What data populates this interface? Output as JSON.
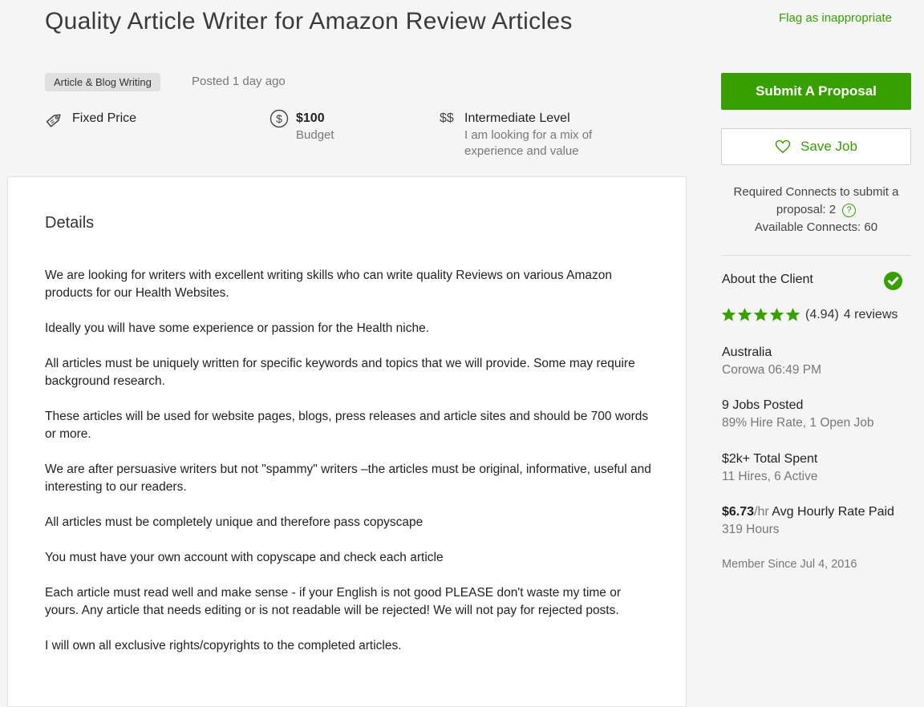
{
  "job": {
    "title": "Quality Article Writer for Amazon Review Articles",
    "flag_label": "Flag as inappropriate",
    "category": "Article & Blog Writing",
    "posted": "Posted 1 day ago",
    "price_type": "Fixed Price",
    "budget_value": "$100",
    "budget_label": "Budget",
    "level_symbol": "$$",
    "level_title": "Intermediate Level",
    "level_desc": "I am looking for a mix of experience and value"
  },
  "details": {
    "heading": "Details",
    "paragraphs": [
      "We are looking for writers with excellent writing skills who can write quality Reviews on various Amazon products for our Health Websites.",
      "Ideally you will have some experience or passion for the Health niche.",
      "All articles must be uniquely written for specific keywords and topics that we will provide. Some may require background research.",
      "These articles will be used for website pages, blogs, press releases and article sites and should be 700 words or more.",
      "We are after persuasive writers but not \"spammy\" writers –the articles must be original, informative, useful and interesting to our readers.",
      "All articles must be completely unique and therefore pass copyscape",
      "You must have your own account with copyscape and check each article",
      "Each article must read well and make sense - if your English is not good PLEASE don't waste my time or yours. Any article that needs editing or is not readable will be rejected! We will not pay for rejected posts.",
      "I will own all exclusive rights/copyrights to the completed articles."
    ]
  },
  "sidebar": {
    "submit_label": "Submit A Proposal",
    "save_label": "Save Job",
    "connects_required": "Required Connects to submit a proposal: 2",
    "connects_available": "Available Connects: 60",
    "help_glyph": "?"
  },
  "client": {
    "heading": "About the Client",
    "rating_value": 4.94,
    "rating_text": "(4.94)",
    "reviews_text": "4 reviews",
    "country": "Australia",
    "city_time": "Corowa 06:49 PM",
    "jobs_posted": "9 Jobs Posted",
    "jobs_sub": "89% Hire Rate, 1 Open Job",
    "total_spent": "$2k+ Total Spent",
    "spent_sub": "11 Hires, 6 Active",
    "rate_value": "$6.73",
    "rate_unit": "/hr",
    "rate_label": "Avg Hourly Rate Paid",
    "hours": "319 Hours",
    "member_since": "Member Since Jul 4, 2016"
  },
  "colors": {
    "accent": "#37a000",
    "background": "#f5f5f5"
  },
  "icons": [
    "tag-icon",
    "dollar-circle-icon",
    "heart-icon",
    "help-icon",
    "verified-check-icon",
    "star-icon"
  ]
}
